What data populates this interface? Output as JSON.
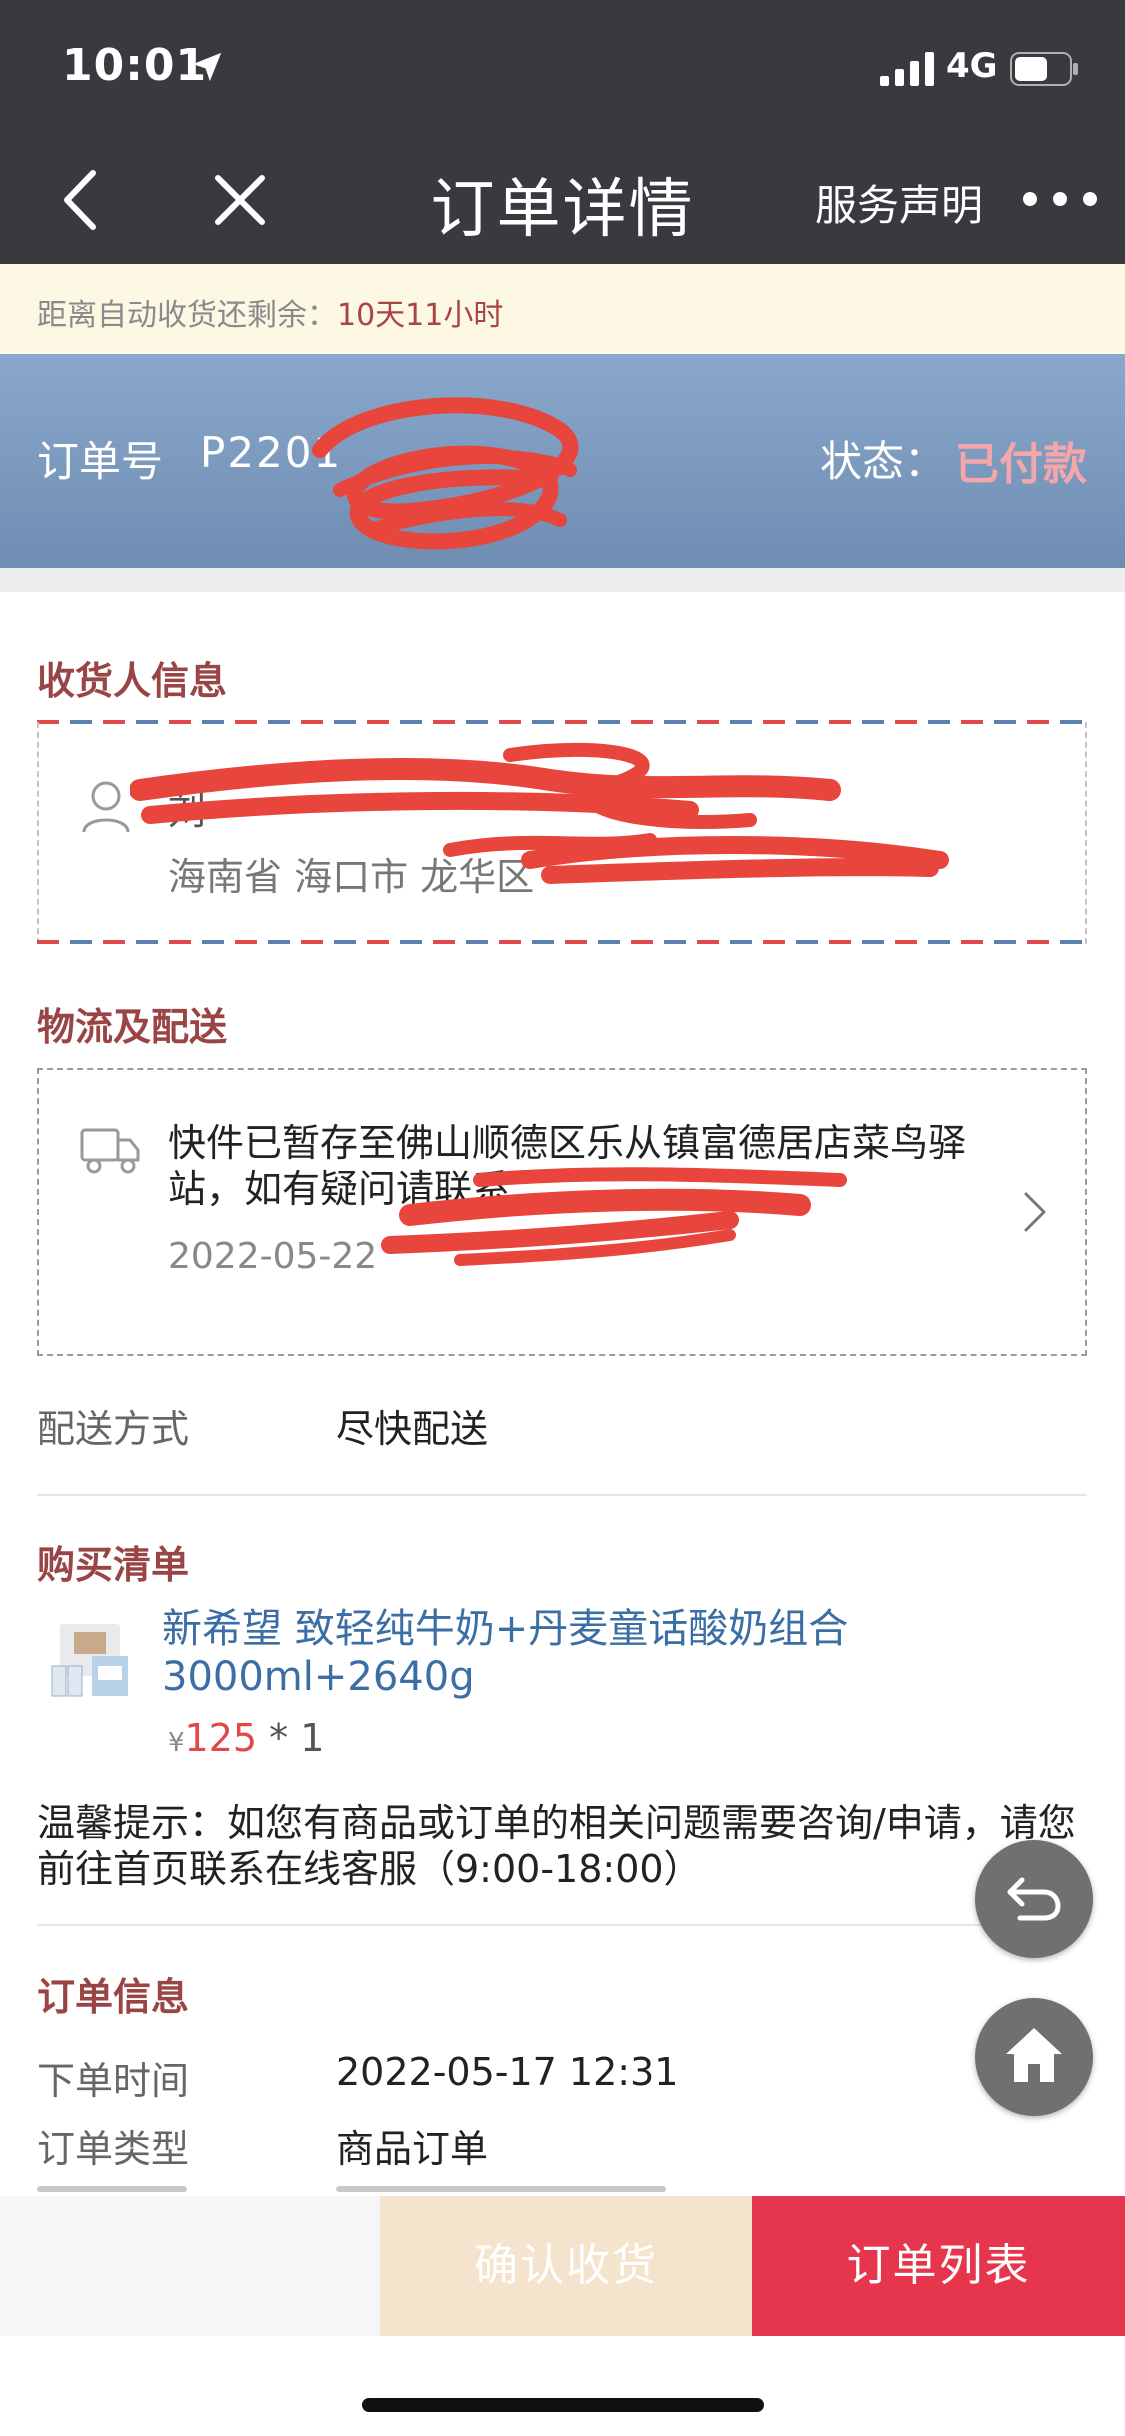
{
  "status_bar": {
    "time": "10:01",
    "network": "4G"
  },
  "nav": {
    "title": "订单详情",
    "service": "服务声明"
  },
  "notice": {
    "label": "距离自动收货还剩余：",
    "value": "10天11小时"
  },
  "order": {
    "no_label": "订单号",
    "no_value": "P2201",
    "status_label": "状态：",
    "status_value": "已付款"
  },
  "receiver": {
    "title": "收货人信息",
    "name_line": "刘",
    "address_line": "海南省 海口市 龙华区"
  },
  "logistics": {
    "title": "物流及配送",
    "message": "快件已暂存至佛山顺德区乐从镇富德居店菜鸟驿站，如有疑问请联系",
    "time": "2022-05-22",
    "delivery_label": "配送方式",
    "delivery_value": "尽快配送"
  },
  "purchase": {
    "title": "购买清单",
    "product_name": "新希望 致轻纯牛奶+丹麦童话酸奶组合3000ml+2640g",
    "currency": "¥",
    "price": "125",
    "qty": "* 1"
  },
  "tip": "温馨提示：如您有商品或订单的相关问题需要咨询/申请，请您前往首页联系在线客服（9:00-18:00）",
  "order_info": {
    "title": "订单信息",
    "rows": [
      {
        "label": "下单时间",
        "value": "2022-05-17 12:31"
      },
      {
        "label": "订单类型",
        "value": "商品订单"
      }
    ]
  },
  "buttons": {
    "confirm": "确认收货",
    "list": "订单列表"
  },
  "colors": {
    "accent_red": "#e5364d",
    "section_title": "#9a4545",
    "link_blue": "#3a6ea5",
    "status_pink": "#f4a6a8"
  }
}
